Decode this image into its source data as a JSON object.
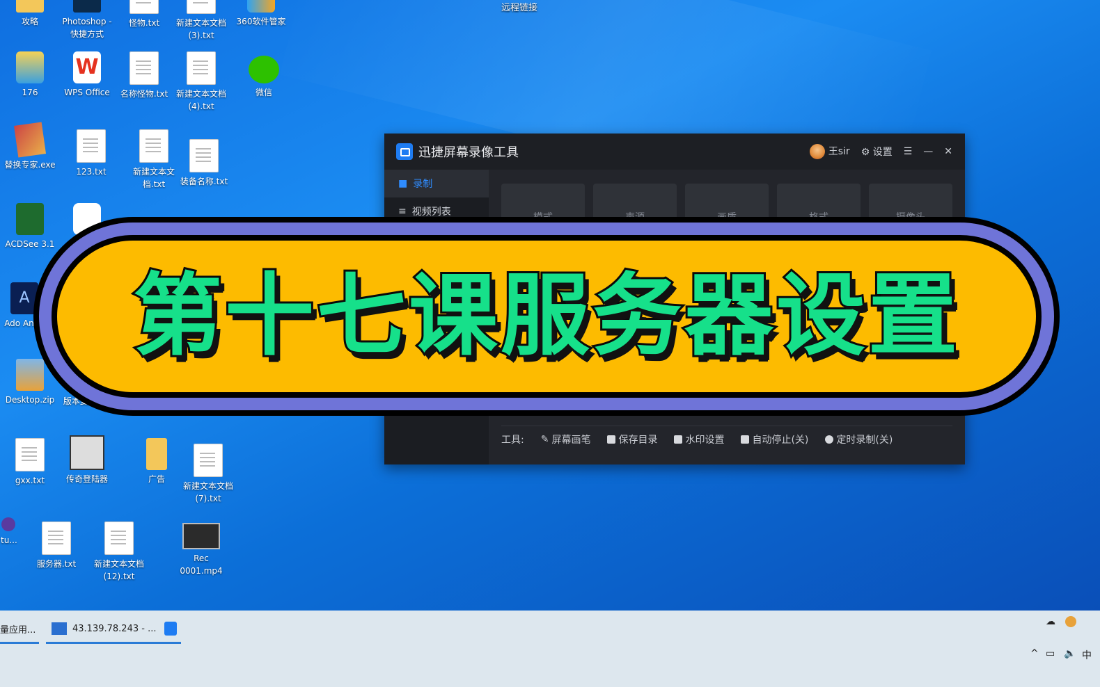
{
  "desktop_icons": [
    {
      "label": "攻略",
      "col": 0,
      "row": 0
    },
    {
      "label": "Photoshop - 快捷方式",
      "col": 1,
      "row": 0
    },
    {
      "label": "怪物.txt",
      "col": 2,
      "row": 0
    },
    {
      "label": "新建文本文档 (3).txt",
      "col": 3,
      "row": 0
    },
    {
      "label": "360软件管家",
      "col": 4,
      "row": 0
    },
    {
      "label": "176",
      "col": 0,
      "row": 1
    },
    {
      "label": "WPS Office",
      "col": 1,
      "row": 1
    },
    {
      "label": "名称怪物.txt",
      "col": 2,
      "row": 1
    },
    {
      "label": "新建文本文档 (4).txt",
      "col": 3,
      "row": 1
    },
    {
      "label": "微信",
      "col": 4,
      "row": 1
    },
    {
      "label": "替换专家.exe",
      "col": 0,
      "row": 2
    },
    {
      "label": "123.txt",
      "col": 1,
      "row": 2
    },
    {
      "label": "新建文本文档.txt",
      "col": 2,
      "row": 2
    },
    {
      "label": "装备名称.txt",
      "col": 3,
      "row": 2
    },
    {
      "label": "ACDSee 3.1",
      "col": 0,
      "row": 3
    },
    {
      "label": "Ado Anim",
      "col": 0,
      "row": 4
    },
    {
      "label": "Desktop.zip",
      "col": 0,
      "row": 5
    },
    {
      "label": "版本复制.txt",
      "col": 1,
      "row": 5
    },
    {
      "label": "gxx.txt",
      "col": 0,
      "row": 6
    },
    {
      "label": "传奇登陆器",
      "col": 1,
      "row": 6
    },
    {
      "label": "广告",
      "col": 2,
      "row": 6
    },
    {
      "label": "新建文本文档 (7).txt",
      "col": 3,
      "row": 6
    },
    {
      "label": "oft tu...",
      "col": 0,
      "row": 7
    },
    {
      "label": "服务器.txt",
      "col": 1,
      "row": 7
    },
    {
      "label": "新建文本文档 (12).txt",
      "col": 2,
      "row": 7
    },
    {
      "label": "Rec 0001.mp4",
      "col": 3,
      "row": 7
    }
  ],
  "top_partial_label": "远程链接",
  "app": {
    "title": "迅捷屏幕录像工具",
    "user": "王sir",
    "settings_label": "设置",
    "sidebar": [
      {
        "label": "录制",
        "active": true
      },
      {
        "label": "视频列表",
        "active": false
      }
    ],
    "tabs": [
      "模式",
      "声源",
      "画质",
      "格式",
      "摄像头"
    ],
    "toolbar_label": "工具:",
    "tools": [
      "屏幕画笔",
      "保存目录",
      "水印设置",
      "自动停止(关)",
      "定时录制(关)"
    ]
  },
  "banner": {
    "text": "第十七课服务器设置"
  },
  "taskbar": {
    "items": [
      {
        "label": "量应用..."
      },
      {
        "label": "43.139.78.243 - ..."
      }
    ],
    "tray_lang": "中"
  },
  "colors": {
    "banner_fill": "#fdbb00",
    "banner_text": "#16e08a",
    "banner_ring": "#6f74d8",
    "accent": "#1e7cf2"
  }
}
